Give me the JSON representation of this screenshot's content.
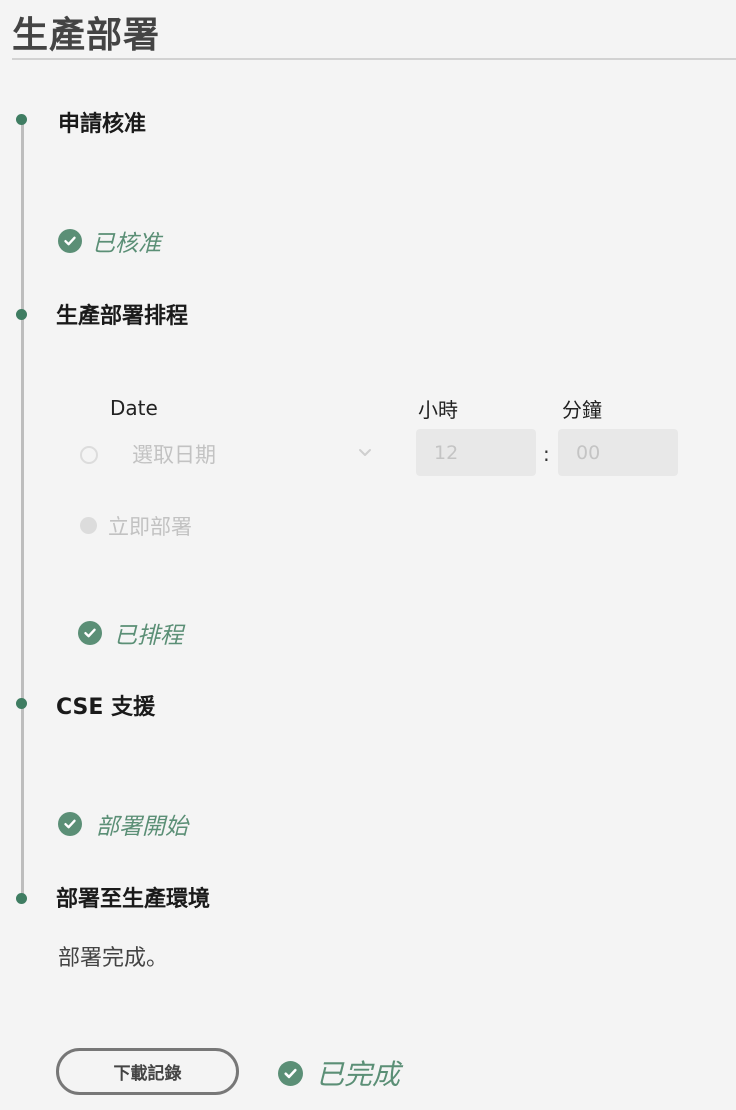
{
  "page": {
    "title": "生產部署"
  },
  "steps": [
    {
      "title": "申請核准",
      "status": "已核准"
    },
    {
      "title": "生產部署排程",
      "status": "已排程"
    },
    {
      "title": "CSE 支援",
      "status": "部署開始"
    },
    {
      "title": "部署至生產環境",
      "message": "部署完成。",
      "status": "已完成"
    }
  ],
  "schedule": {
    "date_label": "Date",
    "hour_label": "小時",
    "minute_label": "分鐘",
    "date_placeholder": "選取日期",
    "hour_value": "12",
    "minute_value": "00",
    "separator": ":",
    "immediate_label": "立即部署"
  },
  "actions": {
    "download_label": "下載記錄"
  },
  "colors": {
    "accent": "#5b8f76",
    "dot": "#3f7d62",
    "background": "#f4f4f4"
  },
  "icons": {
    "check": "check-circle-icon",
    "chevron": "chevron-down-icon"
  }
}
